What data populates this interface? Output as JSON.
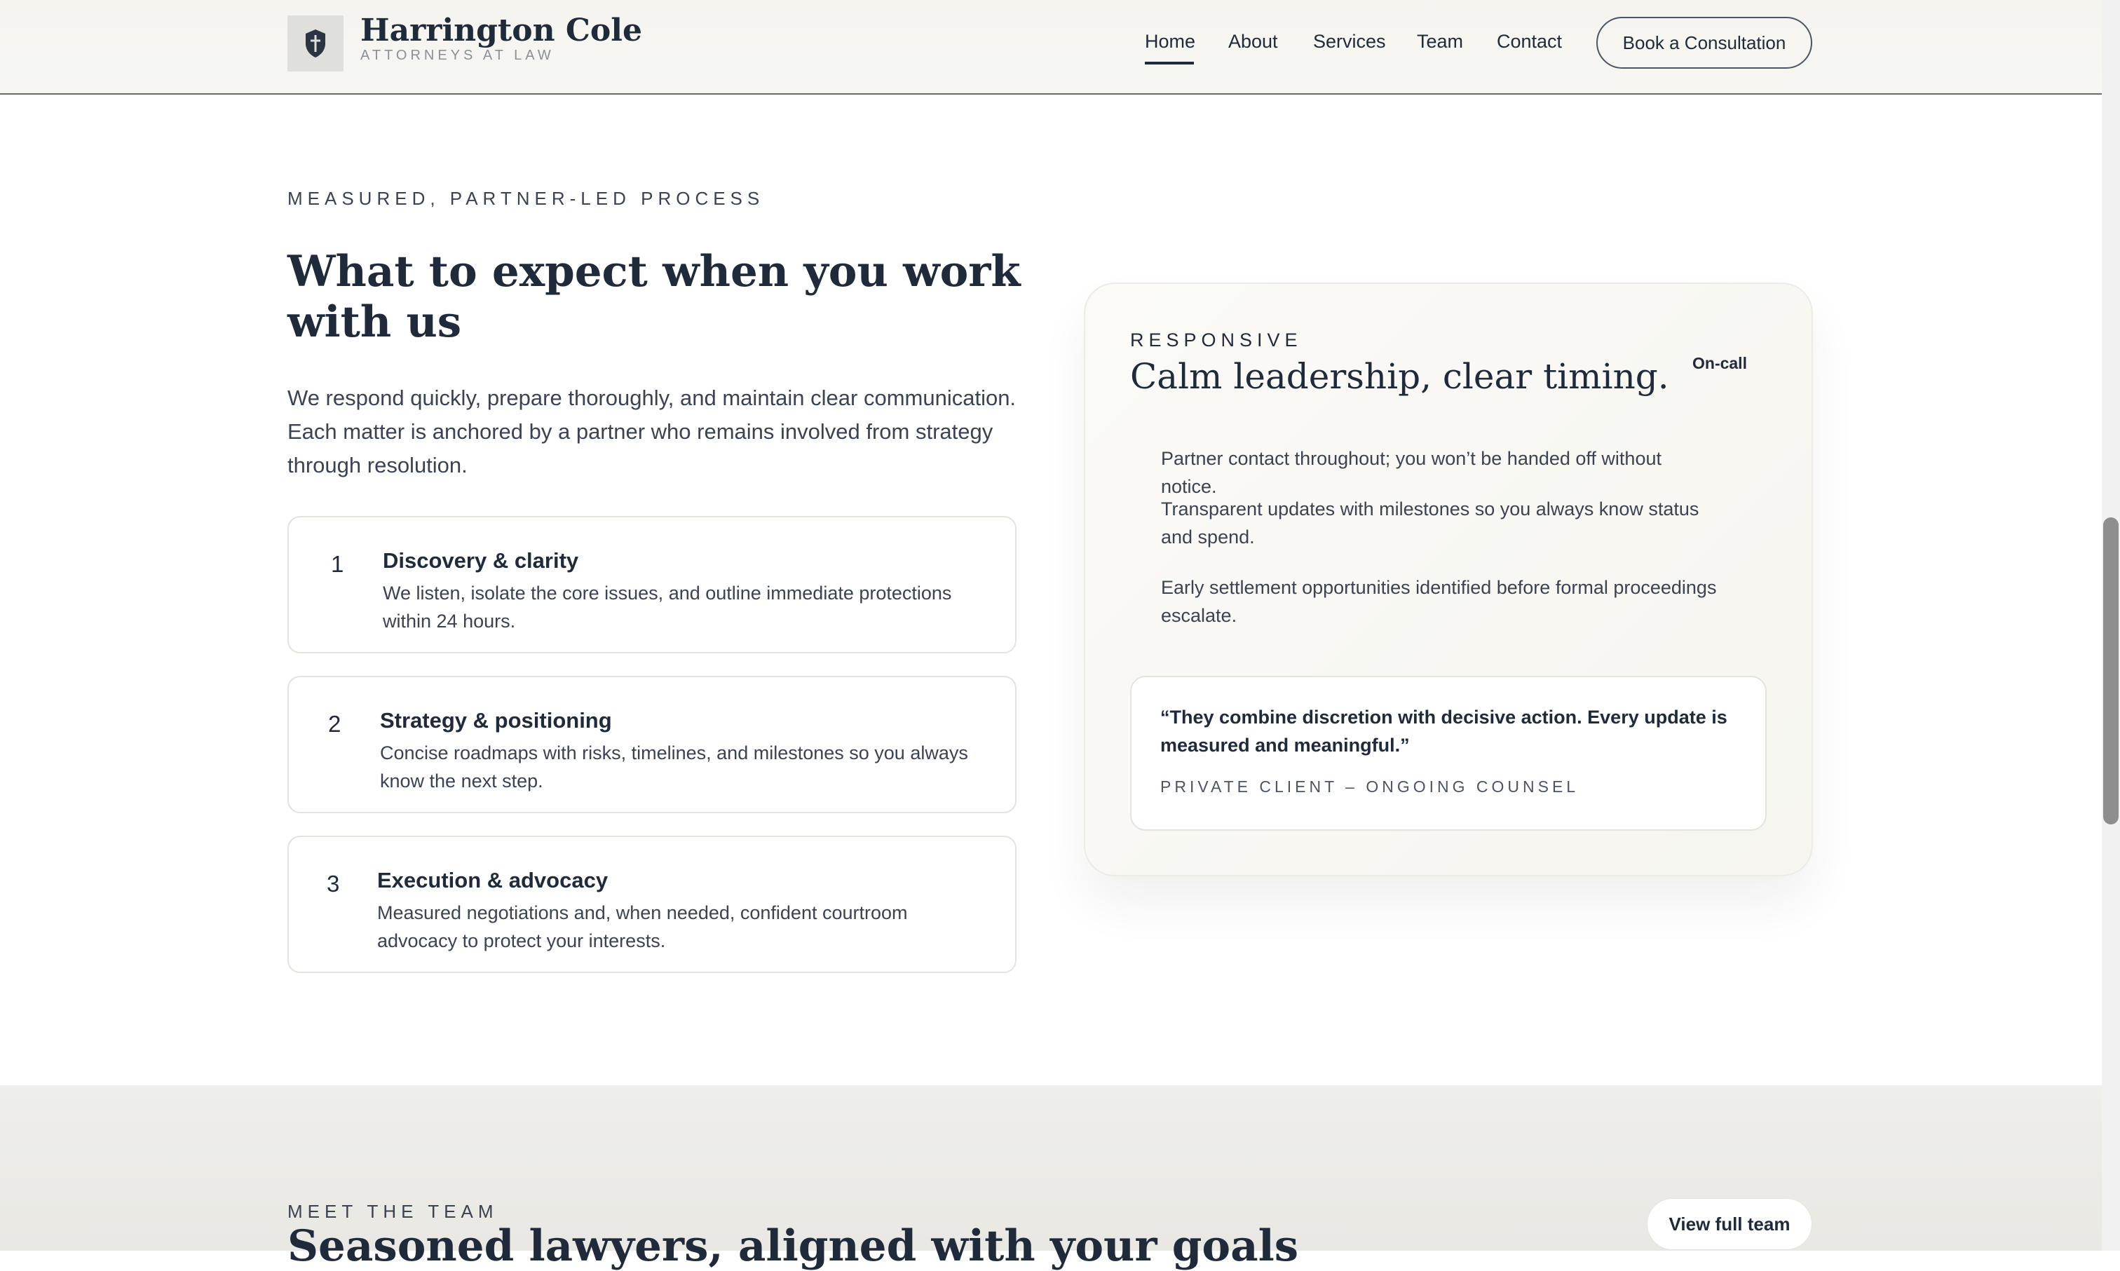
{
  "header": {
    "brand_name": "Harrington Cole",
    "brand_tagline": "ATTORNEYS AT LAW",
    "nav": [
      "Home",
      "About",
      "Services",
      "Team",
      "Contact"
    ],
    "active_nav": "Home",
    "cta_label": "Book a Consultation"
  },
  "process": {
    "eyebrow": "MEASURED, PARTNER-LED PROCESS",
    "title": "What to expect when you work with us",
    "lede": "We respond quickly, prepare thoroughly, and maintain clear communication. Each matter is anchored by a partner who remains involved from strategy through resolution.",
    "steps": [
      {
        "num": "1",
        "title": "Discovery & clarity",
        "body": "We listen, isolate the core issues, and outline immediate protections within 24 hours."
      },
      {
        "num": "2",
        "title": "Strategy & positioning",
        "body": "Concise roadmaps with risks, timelines, and milestones so you always know the next step."
      },
      {
        "num": "3",
        "title": "Execution & advocacy",
        "body": "Measured negotiations and, when needed, confident courtroom advocacy to protect your interests."
      }
    ]
  },
  "card": {
    "eyebrow": "RESPONSIVE",
    "title": "Calm leadership, clear timing.",
    "badge": "On-call",
    "bullets": [
      "Partner contact throughout; you won’t be handed off without notice.",
      "Transparent updates with milestones so you always know status and spend.",
      "Early settlement opportunities identified before formal proceedings escalate."
    ],
    "quote": "“They combine discretion with decisive action. Every update is measured and meaningful.”",
    "quote_attribution": "PRIVATE CLIENT – ONGOING COUNSEL"
  },
  "team": {
    "eyebrow": "MEET THE TEAM",
    "title": "Seasoned lawyers, aligned with your goals",
    "button_label": "View full team"
  }
}
